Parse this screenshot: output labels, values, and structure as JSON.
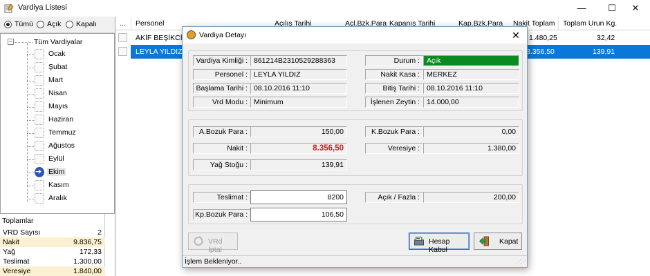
{
  "window": {
    "title": "Vardiya Listesi",
    "minimize": "—",
    "maximize": "☐",
    "close": "✕"
  },
  "filter": {
    "all": "Tümü",
    "open": "Açık",
    "closed": "Kapalı",
    "selected": "all"
  },
  "tree": {
    "root": "Tüm Vardiyalar",
    "months": [
      "Ocak",
      "Şubat",
      "Mart",
      "Nisan",
      "Mayıs",
      "Haziran",
      "Temmuz",
      "Ağustos",
      "Eylül",
      "Ekim",
      "Kasım",
      "Aralık"
    ],
    "selected": "Ekim"
  },
  "totals": {
    "title": "Toplamlar",
    "rows": [
      {
        "label": "VRD Sayısı",
        "value": "2"
      },
      {
        "label": "Nakit",
        "value": "9.836,75"
      },
      {
        "label": "Yağ",
        "value": "172,33"
      },
      {
        "label": "Teslimat",
        "value": "1.300,00"
      },
      {
        "label": "Veresiye",
        "value": "1.840,00"
      }
    ]
  },
  "grid": {
    "columns": [
      "...",
      "Personel",
      "Açılış Tarihi",
      "Açl.Bzk.Para",
      "Kapanış Tarihi",
      "Kap.Bzk.Para",
      "Nakit Toplam",
      "Toplam Urun Kg."
    ],
    "rows": [
      {
        "personel": "AKİF BEŞİKCİ",
        "nakit": "1.480,25",
        "urun": "32,42",
        "selected": false
      },
      {
        "personel": "LEYLA YILDIZ",
        "nakit": "8.356,50",
        "urun": "139,91",
        "selected": true
      }
    ]
  },
  "dialog": {
    "title": "Vardiya Detayı",
    "close": "✕",
    "info": {
      "vardiya_kimligi_label": "Vardiya Kimliği :",
      "vardiya_kimligi": "861214B2310529288363",
      "personel_label": "Personel :",
      "personel": "LEYLA YILDIZ",
      "baslama_label": "Başlama Tarihi :",
      "baslama": "08.10.2016 11:10",
      "vrd_modu_label": "Vrd Modu :",
      "vrd_modu": "Minimum",
      "durum_label": "Durum :",
      "durum": "Açık",
      "nakit_kasa_label": "Nakit Kasa :",
      "nakit_kasa": "MERKEZ",
      "bitis_label": "Bitiş Tarihi :",
      "bitis": "08.10.2016 11:10",
      "zeytin_label": "İşlenen Zeytin :",
      "zeytin": "14.000,00"
    },
    "money": {
      "a_bozuk_label": "A.Bozuk Para :",
      "a_bozuk": "150,00",
      "nakit_label": "Nakit :",
      "nakit": "8.356,50",
      "yag_label": "Yağ Stoğu :",
      "yag": "139,91",
      "k_bozuk_label": "K.Bozuk Para :",
      "k_bozuk": "0,00",
      "veresiye_label": "Veresiye :",
      "veresiye": "1.380,00"
    },
    "delivery": {
      "teslimat_label": "Teslimat :",
      "teslimat": "8200",
      "kp_bozuk_label": "Kp.Bozuk Para :",
      "kp_bozuk": "106,50",
      "acik_fazla_label": "Açık / Fazla :",
      "acik_fazla": "200,00"
    },
    "buttons": {
      "vrd_iptal": "VRd İptal",
      "hesap_kabul": "Hesap Kabul",
      "kapat": "Kapat"
    },
    "status": "İşlem Bekleniyor..",
    "colors": {
      "durum_green": "#0b8a22",
      "nakit_red": "#d21a1a",
      "selection_blue": "#0b78d7"
    }
  }
}
